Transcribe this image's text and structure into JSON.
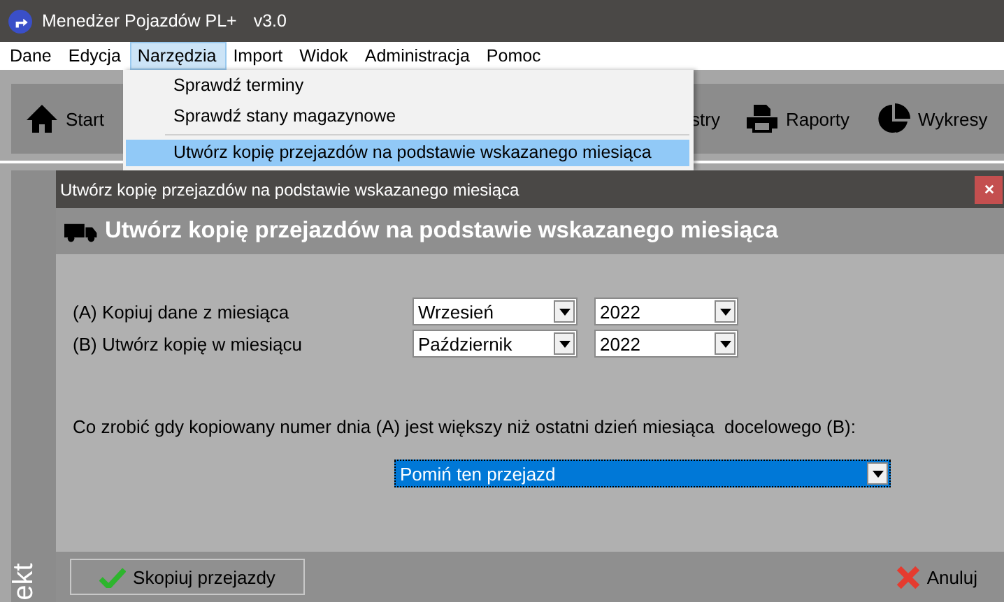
{
  "window": {
    "title": "Menedżer Pojazdów PL+",
    "version": "v3.0"
  },
  "menu": [
    {
      "label": "Dane",
      "selected": false
    },
    {
      "label": "Edycja",
      "selected": false
    },
    {
      "label": "Narzędzia",
      "selected": true
    },
    {
      "label": "Import",
      "selected": false
    },
    {
      "label": "Widok",
      "selected": false
    },
    {
      "label": "Administracja",
      "selected": false
    },
    {
      "label": "Pomoc",
      "selected": false
    }
  ],
  "dropdown": [
    {
      "kind": "item",
      "label": "Sprawdź terminy",
      "selected": false
    },
    {
      "kind": "item",
      "label": "Sprawdź stany magazynowe",
      "selected": false
    },
    {
      "kind": "separator"
    },
    {
      "kind": "item",
      "label": "Utwórz kopię przejazdów na podstawie wskazanego miesiąca",
      "selected": true
    }
  ],
  "toolbar": [
    {
      "kind": "home",
      "label": "Start"
    },
    {
      "kind": "plain",
      "label": "stry"
    },
    {
      "kind": "printer",
      "label": "Raporty"
    },
    {
      "kind": "pie",
      "label": "Wykresy"
    }
  ],
  "side_tab": "ekt",
  "dialog": {
    "title": "Utwórz kopię przejazdów na podstawie wskazanego miesiąca",
    "heading": "Utwórz kopię przejazdów na podstawie wskazanego miesiąca",
    "rows": [
      {
        "label": "(A) Kopiuj dane z miesiąca",
        "month": "Wrzesień",
        "year": "2022"
      },
      {
        "label": "(B) Utwórz kopię w miesiącu",
        "month": "Październik",
        "year": "2022"
      }
    ],
    "question": "Co zrobić gdy kopiowany numer dnia (A) jest większy niż ostatni dzień miesiąca  docelowego (B):",
    "action": {
      "value": "Pomiń ten przejazd",
      "selected": true
    },
    "buttons": [
      {
        "kind": "confirm",
        "label": "Skopiuj przejazdy"
      },
      {
        "kind": "cancel",
        "label": "Anuluj"
      }
    ]
  }
}
